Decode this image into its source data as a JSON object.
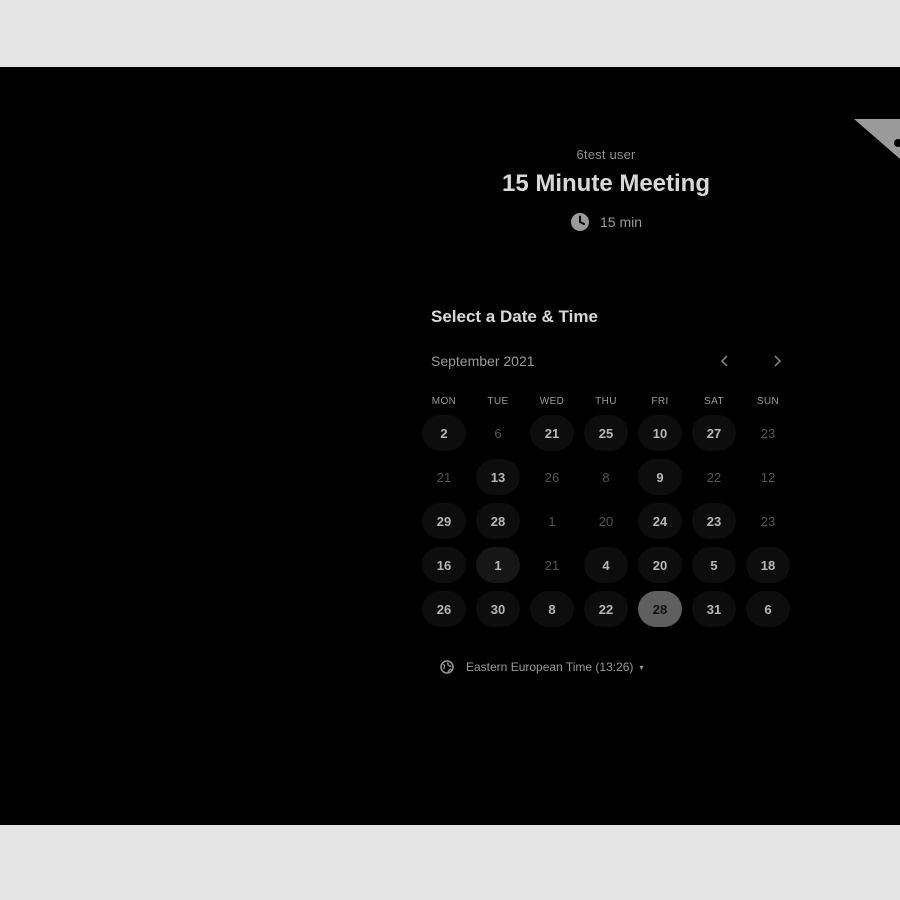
{
  "header": {
    "organizer": "6test user",
    "title": "15 Minute Meeting",
    "duration": "15 min"
  },
  "calendar": {
    "section_title": "Select a Date & Time",
    "month": "September 2021",
    "prev_icon": "chevron-left-icon",
    "next_icon": "chevron-right-icon",
    "weekdays": [
      "MON",
      "TUE",
      "WED",
      "THU",
      "FRI",
      "SAT",
      "SUN"
    ],
    "weeks": [
      [
        {
          "label": "2",
          "available": true
        },
        {
          "label": "6",
          "available": false
        },
        {
          "label": "21",
          "available": true
        },
        {
          "label": "25",
          "available": true
        },
        {
          "label": "10",
          "available": true
        },
        {
          "label": "27",
          "available": true
        },
        {
          "label": "23",
          "available": false
        }
      ],
      [
        {
          "label": "21",
          "available": false
        },
        {
          "label": "13",
          "available": true
        },
        {
          "label": "26",
          "available": false
        },
        {
          "label": "8",
          "available": false
        },
        {
          "label": "9",
          "available": true
        },
        {
          "label": "22",
          "available": false
        },
        {
          "label": "12",
          "available": false
        }
      ],
      [
        {
          "label": "29",
          "available": true
        },
        {
          "label": "28",
          "available": true
        },
        {
          "label": "1",
          "available": false
        },
        {
          "label": "20",
          "available": false
        },
        {
          "label": "24",
          "available": true
        },
        {
          "label": "23",
          "available": true
        },
        {
          "label": "23",
          "available": false
        }
      ],
      [
        {
          "label": "16",
          "available": true
        },
        {
          "label": "1",
          "available": true,
          "highlight": true
        },
        {
          "label": "21",
          "available": false
        },
        {
          "label": "4",
          "available": true
        },
        {
          "label": "20",
          "available": true
        },
        {
          "label": "5",
          "available": true
        },
        {
          "label": "18",
          "available": true
        }
      ],
      [
        {
          "label": "26",
          "available": true
        },
        {
          "label": "30",
          "available": true
        },
        {
          "label": "8",
          "available": true
        },
        {
          "label": "22",
          "available": true
        },
        {
          "label": "28",
          "available": true,
          "selected": true
        },
        {
          "label": "31",
          "available": true
        },
        {
          "label": "6",
          "available": true
        }
      ]
    ]
  },
  "timezone": {
    "label": "Eastern European Time (13:26)",
    "icon": "globe-icon",
    "caret": "▾"
  },
  "colors": {
    "background": "#000000",
    "page_frame": "#e5e5e5",
    "selected_day": "#5f5f5f"
  }
}
